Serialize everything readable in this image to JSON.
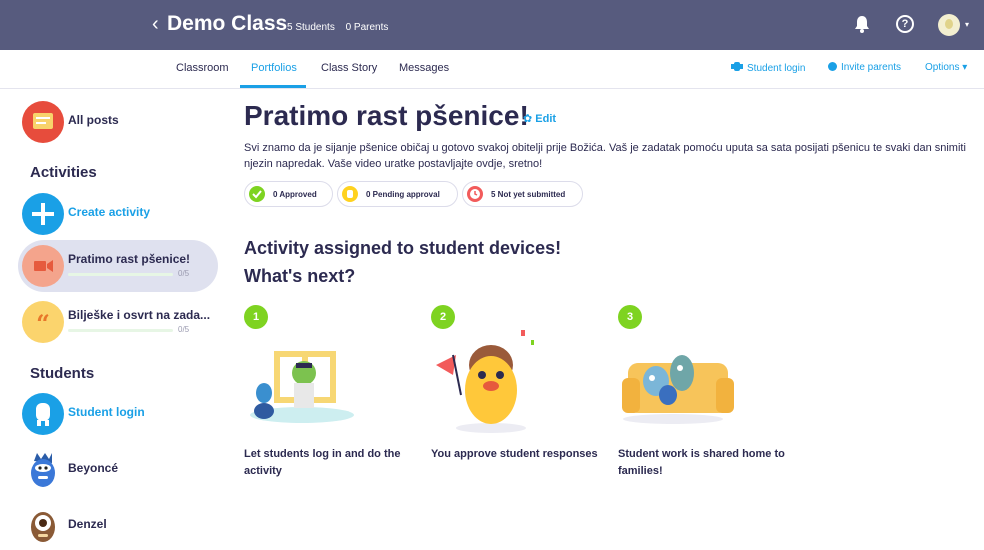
{
  "topbar": {
    "back": "‹",
    "class_name": "Demo Class",
    "students_count": "5 Students",
    "parents_count": "0 Parents",
    "help": "?"
  },
  "tabs": [
    {
      "label": "Classroom"
    },
    {
      "label": "Portfolios"
    },
    {
      "label": "Class Story"
    },
    {
      "label": "Messages"
    }
  ],
  "actions": {
    "student_login": "Student login",
    "invite_parents": "Invite parents",
    "options": "Options"
  },
  "sidebar": {
    "all_posts": "All posts",
    "activities_heading": "Activities",
    "create_activity": "Create activity",
    "activity_1": {
      "name": "Pratimo rast pšenice!",
      "progress": "0/5"
    },
    "activity_2": {
      "name": "Bilješke i osvrt na zada...",
      "progress": "0/5"
    },
    "students_heading": "Students",
    "student_login": "Student login",
    "students": [
      "Beyoncé",
      "Denzel"
    ]
  },
  "main": {
    "title": "Pratimo rast pšenice!",
    "edit": "Edit",
    "description": "Svi znamo da je sijanje pšenice običaj u gotovo svakoj obitelji prije Božića. Vaš je zadatak pomoću uputa sa sata posijati pšenicu te svaki dan snimiti njezin napredak. Vaše video uratke postavljajte ovdje, sretno!",
    "status": {
      "approved": "0 Approved",
      "pending": "0 Pending approval",
      "not_submitted": "5 Not yet submitted"
    },
    "assigned": "Activity assigned to student devices!",
    "whats_next": "What's next?",
    "steps": [
      {
        "num": "1",
        "text": "Let students log in and do the activity"
      },
      {
        "num": "2",
        "text": "You approve student responses"
      },
      {
        "num": "3",
        "text": "Student work is shared home to families!"
      }
    ]
  },
  "colors": {
    "topbar": "#575b7e",
    "accent": "#1aa0e6",
    "green": "#7ed321",
    "pending": "#ffd21f",
    "not_submitted": "#f25b5b"
  }
}
